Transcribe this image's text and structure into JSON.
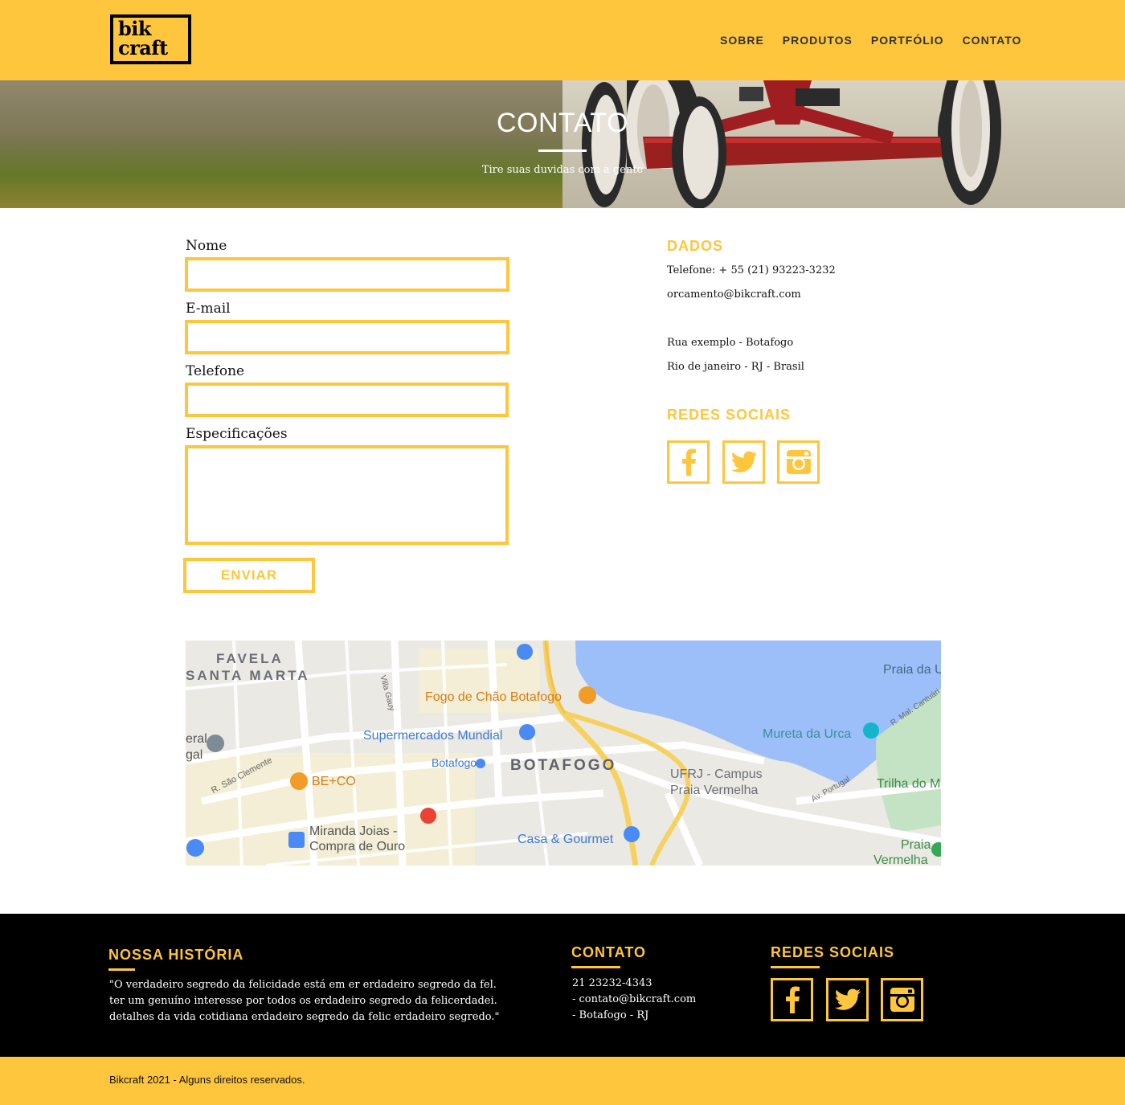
{
  "header": {
    "logo_line1": "bik",
    "logo_line2": "craft",
    "nav": [
      "SOBRE",
      "PRODUTOS",
      "PORTFÓLIO",
      "CONTATO"
    ]
  },
  "hero": {
    "title": "CONTATO",
    "subtitle": "Tire suas duvidas com a gente"
  },
  "form": {
    "name_label": "Nome",
    "email_label": "E-mail",
    "phone_label": "Telefone",
    "specs_label": "Especificações",
    "name_value": "",
    "email_value": "",
    "phone_value": "",
    "specs_value": "",
    "submit_label": "ENVIAR"
  },
  "info": {
    "dados_heading": "DADOS",
    "phone": "Telefone: + 55 (21) 93223-3232",
    "email": "orcamento@bikcraft.com",
    "address1": "Rua exemplo - Botafogo",
    "address2": "Rio de janeiro - RJ - Brasil",
    "social_heading": "REDES SOCIAIS",
    "social_icons": [
      "facebook-icon",
      "twitter-icon",
      "instagram-icon"
    ]
  },
  "map": {
    "labels": {
      "favela1": "FAVELA",
      "favela2": "SANTA MARTA",
      "villa": "Villa Gauy",
      "fogo": "Fogo de Chão Botafogo",
      "praia_da": "Praia da U",
      "mal": "R. Mal. Cantuári",
      "super": "Supermercados Mundial",
      "mureta": "Mureta da Urca",
      "eral": "eral",
      "gal": "gal",
      "sao": "R. São Clemente",
      "botafogo_metro": "Botafogo",
      "botafogo": "BOTAFOGO",
      "ufrj1": "UFRJ - Campus",
      "ufrj2": "Praia Vermelha",
      "trilha": "Trilha do M",
      "beco": "BE+CO",
      "portugal": "Av. Portugal",
      "miranda1": "Miranda Joias -",
      "miranda2": "Compra de Ouro",
      "casa": "Casa & Gourmet",
      "praia_v1": "Praia",
      "praia_v2": "Vermelha"
    }
  },
  "footer": {
    "history_heading": "NOSSA HISTÓRIA",
    "history_line1": "\"O verdadeiro segredo da felicidade está em er  erdadeiro segredo da fel.",
    "history_line2": " ter um genuíno interesse por todos os erdadeiro segredo da felicerdadei.",
    "history_line3": " detalhes da vida cotidiana erdadeiro segredo da felic erdadeiro segredo.\"",
    "contact_heading": "CONTATO",
    "contact_phone": "21 23232-4343",
    "contact_email": "- contato@bikcraft.com",
    "contact_place": "- Botafogo - RJ",
    "social_heading": "REDES SOCIAIS",
    "copyright": "Bikcraft 2021 - Alguns direitos reservados."
  },
  "colors": {
    "brand_yellow": "#fec63d",
    "black": "#000000",
    "water": "#9cbffa"
  }
}
